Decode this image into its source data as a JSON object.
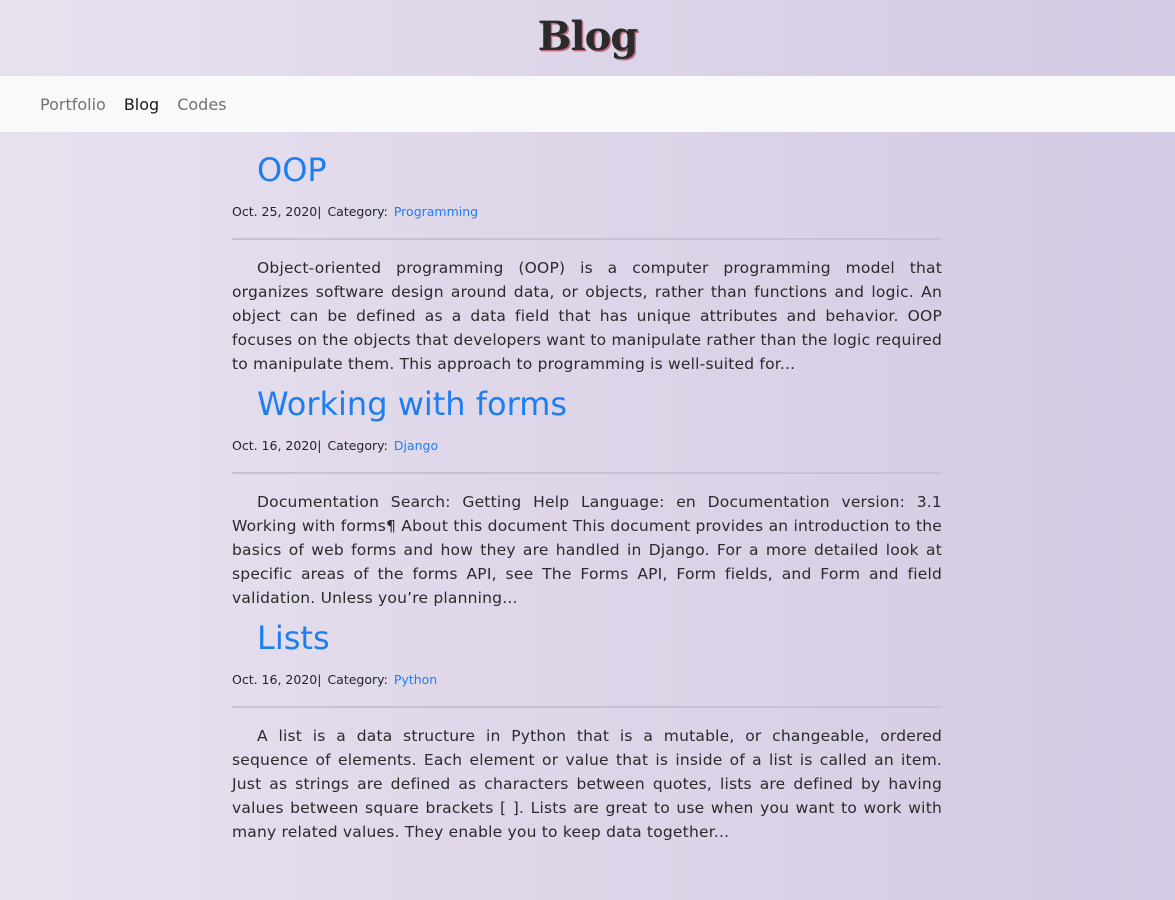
{
  "header": {
    "title": "Blog"
  },
  "nav": {
    "items": [
      {
        "label": "Portfolio"
      },
      {
        "label": "Blog"
      },
      {
        "label": "Codes"
      }
    ]
  },
  "posts": [
    {
      "title": "OOP",
      "date": "Oct. 25, 2020",
      "separator": "|",
      "category_label": "Category:",
      "category": "Programming",
      "excerpt": "Object-oriented programming (OOP) is a computer programming model that organizes software design around data, or objects, rather than functions and logic. An object can be defined as a data field that has unique attributes and behavior. OOP focuses on the objects that developers want to manipulate rather than the logic required to manipulate them. This approach to programming is well-suited for..."
    },
    {
      "title": "Working with forms",
      "date": "Oct. 16, 2020",
      "separator": "|",
      "category_label": "Category:",
      "category": "Django",
      "excerpt": "Documentation Search: Getting Help Language: en Documentation version: 3.1 Working with forms¶ About this document This document provides an introduction to the basics of web forms and how they are handled in Django. For a more detailed look at specific areas of the forms API, see The Forms API, Form fields, and Form and field validation. Unless you’re planning..."
    },
    {
      "title": "Lists",
      "date": "Oct. 16, 2020",
      "separator": "|",
      "category_label": "Category:",
      "category": "Python",
      "excerpt": "A list is a data structure in Python that is a mutable, or changeable, ordered sequence of elements. Each element or value that is inside of a list is called an item. Just as strings are defined as characters between quotes, lists are defined by having values between square brackets [ ]. Lists are great to use when you want to work with many related values. They enable you to keep data together..."
    }
  ],
  "colors": {
    "link": "#1e7ef0",
    "navbar_bg": "#f8f9fa",
    "title_shadow": "#c46a84"
  }
}
